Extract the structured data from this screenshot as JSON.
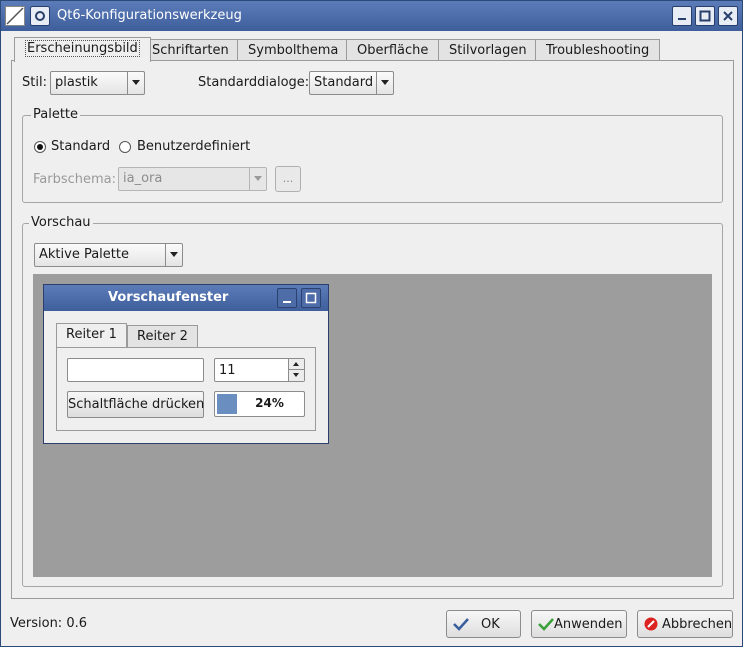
{
  "window": {
    "title": "Qt6-Konfigurationswerkzeug",
    "titlebar_colors": {
      "start": "#5b7cb8",
      "end": "#3f5f9c"
    }
  },
  "tabs": [
    {
      "label": "Erscheinungsbild",
      "active": true
    },
    {
      "label": "Schriftarten",
      "active": false
    },
    {
      "label": "Symbolthema",
      "active": false
    },
    {
      "label": "Oberfläche",
      "active": false
    },
    {
      "label": "Stilvorlagen",
      "active": false
    },
    {
      "label": "Troubleshooting",
      "active": false
    }
  ],
  "style": {
    "label": "Stil:",
    "value": "plastik"
  },
  "dialogs": {
    "label": "Standarddialoge:",
    "value": "Standard"
  },
  "palette": {
    "title": "Palette",
    "radio_standard": "Standard",
    "radio_custom": "Benutzerdefiniert",
    "selected": "Standard",
    "scheme_label": "Farbschema:",
    "scheme_value": "ia_ora",
    "scheme_button": "..."
  },
  "preview": {
    "title": "Vorschau",
    "palette_combo": "Aktive Palette",
    "window_title": "Vorschaufenster",
    "tab1": "Reiter 1",
    "tab2": "Reiter 2",
    "spin_value": "11",
    "button_label": "Schaltfläche drücken",
    "progress_text": "24%",
    "progress_value": 0.24,
    "background_color": "#9d9d9d"
  },
  "footer": {
    "version": "Version: 0.6",
    "ok": "OK",
    "apply": "Anwenden",
    "cancel": "Abbrechen"
  }
}
